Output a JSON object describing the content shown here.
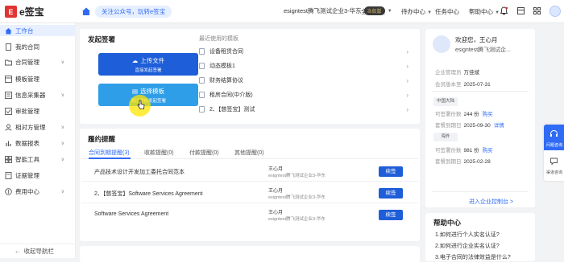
{
  "topbar": {
    "logo_mark": "E",
    "logo_text": "e签宝",
    "promo": "关注公众号，玩转e签宝",
    "company": "esigntest腾飞测试企业3-华东",
    "company_badge": "高级版",
    "nav": [
      "全部企业",
      "待办中心",
      "任务中心",
      "帮助中心"
    ]
  },
  "sidebar": {
    "items": [
      {
        "label": "工作台",
        "has_caret": false
      },
      {
        "label": "我的合同",
        "has_caret": false
      },
      {
        "label": "合同管理",
        "has_caret": true
      },
      {
        "label": "模板管理",
        "has_caret": false
      },
      {
        "label": "信息采集器",
        "has_caret": true
      },
      {
        "label": "审批管理",
        "has_caret": false
      },
      {
        "label": "相对方管理",
        "has_caret": true
      },
      {
        "label": "数据报表",
        "has_caret": true
      },
      {
        "label": "智能工具",
        "has_caret": true
      },
      {
        "label": "证据管理",
        "has_caret": false
      },
      {
        "label": "费用中心",
        "has_caret": true
      }
    ],
    "collapse_label": "收起导航栏"
  },
  "initiate": {
    "title": "发起签署",
    "upload_label": "上传文件",
    "upload_sub": "直接发起签署",
    "template_label": "选择模板",
    "template_sub": "通过模板发起签署",
    "recent_title": "最近使用的模板",
    "recent": [
      "设备租赁合同",
      "动态模板1",
      "财务结算协议",
      "租房合同(中介版)",
      "2、【慈签宝】测试"
    ]
  },
  "reminders": {
    "title": "履约提醒",
    "tabs": [
      "合同到期提醒(3)",
      "收款提醒(0)",
      "付款提醒(0)",
      "其他提醒(0)"
    ],
    "rows": [
      {
        "title": "产品技术设计开发加工委托合同范本",
        "person": "王心月",
        "company": "esigntest腾飞测试企业3-华东",
        "action": "续签"
      },
      {
        "title": "2、【慈签宝】Software Services Agreement",
        "person": "王心月",
        "company": "esigntest腾飞测试企业3-华东",
        "action": "续签"
      },
      {
        "title": "Software Services Agreement",
        "person": "王心月",
        "company": "esigntest腾飞测试企业3-华东",
        "action": "续签"
      }
    ]
  },
  "account": {
    "welcome": "欢迎您，王心月",
    "company": "esigntest腾飞测试企...",
    "admin_label": "企业管理员",
    "admin_value": "万佳斌",
    "member_label": "会员版本至",
    "member_value": "2025-07-31",
    "regions": [
      {
        "name": "中国大陆",
        "quota_label": "可签署份数",
        "quota_value": "244 份",
        "buy": "购买",
        "expiry_label": "套餐到期日",
        "expiry_value": "2025-09-30",
        "detail": "详情"
      },
      {
        "name": "海外",
        "quota_label": "可签署份数",
        "quota_value": "981 份",
        "buy": "购买",
        "expiry_label": "套餐到期日",
        "expiry_value": "2025-02-28",
        "detail": ""
      }
    ],
    "enter_console": "进入企业控制台 >"
  },
  "help": {
    "title": "帮助中心",
    "questions": [
      "1.如何进行个人实名认证?",
      "2.如何进行企业实名认证?",
      "3.电子合同的法律效益是什么?"
    ]
  },
  "float": {
    "top_label": "问题咨询",
    "bottom_label": "渠道咨询"
  },
  "colors": {
    "accent": "#2f6bf5",
    "button": "#1e5ed8",
    "brand_red": "#e23333"
  }
}
